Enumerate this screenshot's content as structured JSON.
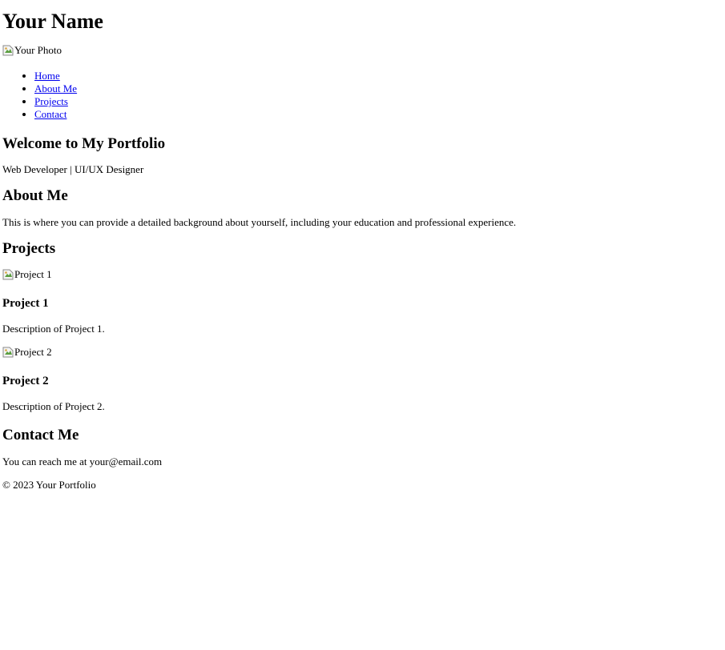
{
  "header": {
    "title": "Your Name",
    "photo_alt": "Your Photo",
    "photo_icon": "broken-image-icon"
  },
  "nav": {
    "items": [
      {
        "label": "Home"
      },
      {
        "label": "About Me"
      },
      {
        "label": "Projects"
      },
      {
        "label": "Contact"
      }
    ],
    "link_color": "#0000EE"
  },
  "hero": {
    "title": "Welcome to My Portfolio",
    "subtitle": "Web Developer | UI/UX Designer"
  },
  "about": {
    "title": "About Me",
    "text": "This is where you can provide a detailed background about yourself, including your education and professional experience."
  },
  "projects": {
    "title": "Projects",
    "items": [
      {
        "image_alt": "Project 1",
        "title": "Project 1",
        "description": "Description of Project 1."
      },
      {
        "image_alt": "Project 2",
        "title": "Project 2",
        "description": "Description of Project 2."
      }
    ]
  },
  "contact": {
    "title": "Contact Me",
    "text": "You can reach me at your@email.com"
  },
  "footer": {
    "text": "© 2023 Your Portfolio"
  }
}
